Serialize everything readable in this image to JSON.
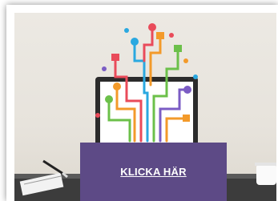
{
  "cta": {
    "label": "KLICKA HÄR"
  },
  "illustration": {
    "name": "app-tree-on-laptop",
    "colors": {
      "desk": "#3a3a3a",
      "laptop": "#2b2b2b",
      "screen": "#ffffff",
      "button": "#5d4a86",
      "line_orange": "#f39a2a",
      "line_red": "#e94b5a",
      "line_blue": "#2aa8e0",
      "line_green": "#6cc04a",
      "line_purple": "#7b5cc4"
    }
  }
}
